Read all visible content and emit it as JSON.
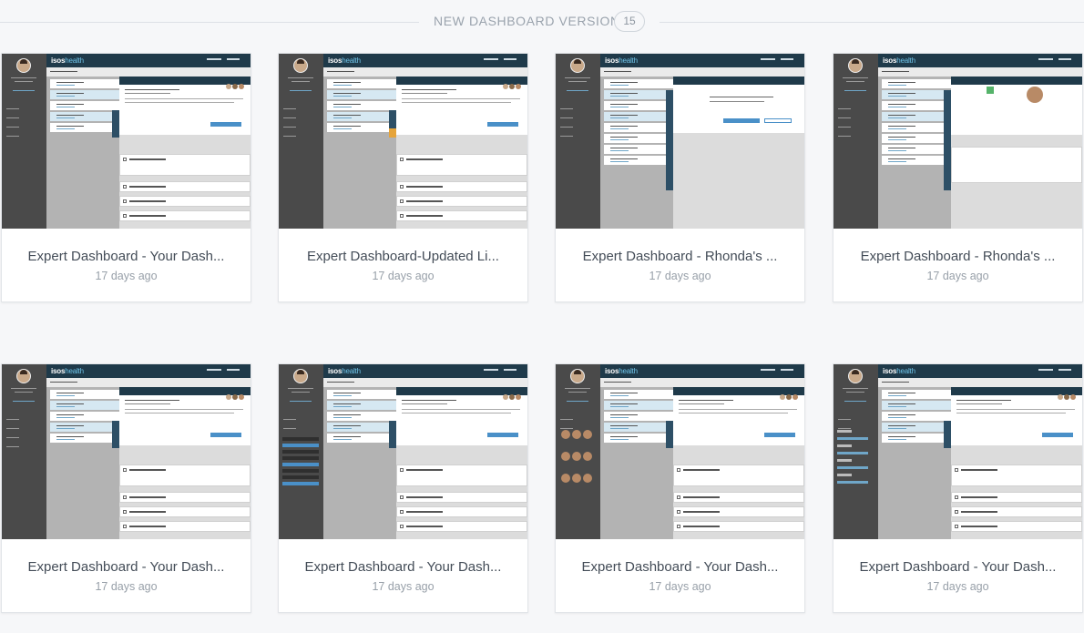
{
  "header": {
    "title": "NEW DASHBOARD VERSION",
    "count": "15"
  },
  "thumb_brand": {
    "logo_prefix": "isos",
    "logo_suffix": "health"
  },
  "cards": [
    {
      "title": "Expert Dashboard - Your Dash...",
      "time": "17 days ago"
    },
    {
      "title": "Expert Dashboard-Updated Li...",
      "time": "17 days ago"
    },
    {
      "title": "Expert Dashboard - Rhonda's ...",
      "time": "17 days ago"
    },
    {
      "title": "Expert Dashboard - Rhonda's ...",
      "time": "17 days ago"
    },
    {
      "title": "Expert Dashboard - Your Dash...",
      "time": "17 days ago"
    },
    {
      "title": "Expert Dashboard - Your Dash...",
      "time": "17 days ago"
    },
    {
      "title": "Expert Dashboard - Your Dash...",
      "time": "17 days ago"
    },
    {
      "title": "Expert Dashboard - Your Dash...",
      "time": "17 days ago"
    }
  ],
  "colors": {
    "navy": "#1f3a4a",
    "sidebar": "#4a4a4a",
    "accent": "#4a90c8",
    "background": "#f6f7f9"
  }
}
